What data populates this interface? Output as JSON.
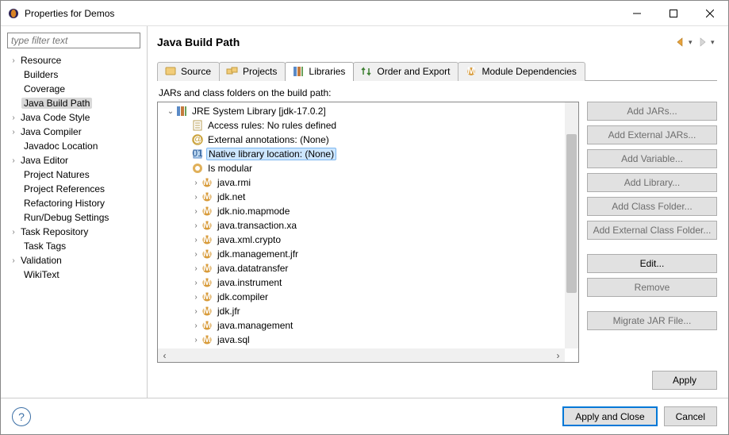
{
  "window": {
    "title": "Properties for Demos"
  },
  "sidebar": {
    "filter_placeholder": "type filter text",
    "items": [
      {
        "label": "Resource",
        "expandable": true
      },
      {
        "label": "Builders"
      },
      {
        "label": "Coverage"
      },
      {
        "label": "Java Build Path",
        "selected": true
      },
      {
        "label": "Java Code Style",
        "expandable": true
      },
      {
        "label": "Java Compiler",
        "expandable": true
      },
      {
        "label": "Javadoc Location"
      },
      {
        "label": "Java Editor",
        "expandable": true
      },
      {
        "label": "Project Natures"
      },
      {
        "label": "Project References"
      },
      {
        "label": "Refactoring History"
      },
      {
        "label": "Run/Debug Settings"
      },
      {
        "label": "Task Repository",
        "expandable": true
      },
      {
        "label": "Task Tags"
      },
      {
        "label": "Validation",
        "expandable": true
      },
      {
        "label": "WikiText"
      }
    ]
  },
  "main": {
    "title": "Java Build Path",
    "tabs": [
      {
        "label": "Source",
        "icon": "source-icon"
      },
      {
        "label": "Projects",
        "icon": "projects-icon"
      },
      {
        "label": "Libraries",
        "icon": "libraries-icon",
        "active": true
      },
      {
        "label": "Order and Export",
        "icon": "order-icon"
      },
      {
        "label": "Module Dependencies",
        "icon": "module-icon"
      }
    ],
    "panel_label": "JARs and class folders on the build path:",
    "library_root": {
      "label": "JRE System Library [jdk-17.0.2]",
      "children_meta": [
        {
          "label": "Access rules: No rules defined",
          "icon": "access-rules-icon"
        },
        {
          "label": "External annotations: (None)",
          "icon": "annotations-icon"
        },
        {
          "label": "Native library location: (None)",
          "icon": "native-lib-icon",
          "selected": true
        },
        {
          "label": "Is modular",
          "icon": "modular-icon"
        }
      ],
      "packages": [
        "java.rmi",
        "jdk.net",
        "jdk.nio.mapmode",
        "java.transaction.xa",
        "java.xml.crypto",
        "jdk.management.jfr",
        "java.datatransfer",
        "java.instrument",
        "jdk.compiler",
        "jdk.jfr",
        "java.management",
        "java.sql"
      ]
    },
    "buttons": [
      {
        "label": "Add JARs...",
        "enabled": false
      },
      {
        "label": "Add External JARs...",
        "enabled": false
      },
      {
        "label": "Add Variable...",
        "enabled": false
      },
      {
        "label": "Add Library...",
        "enabled": false
      },
      {
        "label": "Add Class Folder...",
        "enabled": false
      },
      {
        "label": "Add External Class Folder...",
        "enabled": false
      },
      {
        "label": "Edit...",
        "enabled": true,
        "gap": true
      },
      {
        "label": "Remove",
        "enabled": false
      },
      {
        "label": "Migrate JAR File...",
        "enabled": false,
        "gap": true
      }
    ],
    "apply_label": "Apply"
  },
  "footer": {
    "apply_close": "Apply and Close",
    "cancel": "Cancel"
  }
}
